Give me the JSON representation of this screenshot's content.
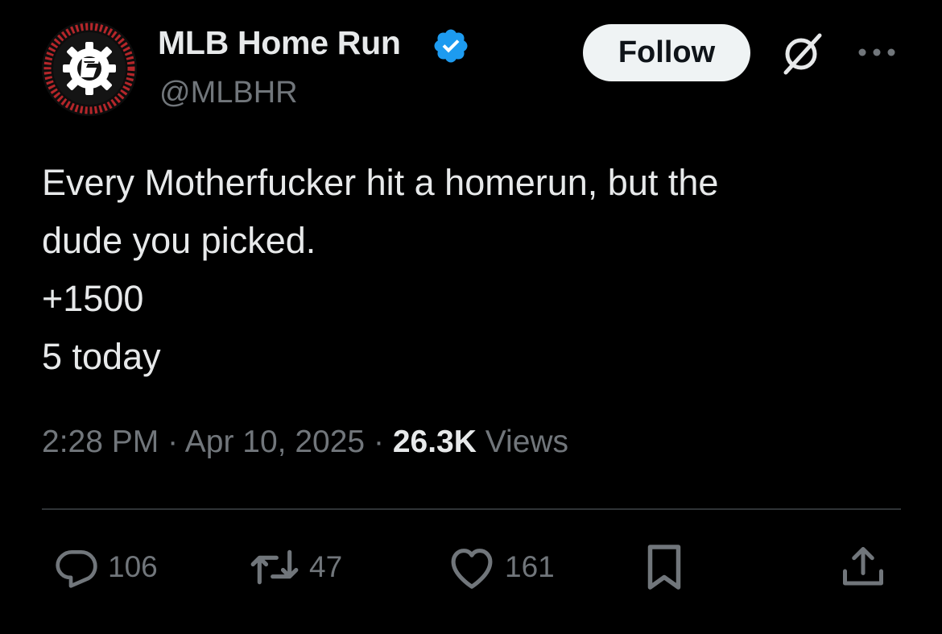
{
  "author": {
    "display_name": "MLB Home Run",
    "handle": "@MLBHR",
    "verified_color": "#1d9bf0",
    "avatar_icon": "gear-g-logo-icon"
  },
  "header": {
    "follow_label": "Follow",
    "grok_icon": "slashed-circle-icon",
    "more_icon": "ellipsis-icon"
  },
  "tweet": {
    "text": "Every Motherfucker hit a homerun, but the\ndude you picked.\n+1500\n5 today"
  },
  "meta": {
    "time": "2:28 PM",
    "separator": "·",
    "date": "Apr 10, 2025",
    "views_count": "26.3K",
    "views_label": "Views"
  },
  "actions": {
    "replies": "106",
    "reposts": "47",
    "likes": "161",
    "bookmark_icon": "bookmark-icon",
    "share_icon": "share-icon"
  },
  "colors": {
    "background": "#000000",
    "text": "#e7e9ea",
    "secondary": "#71767b",
    "divider": "#2f3336",
    "follow_bg": "#eff3f4",
    "avatar_ring": "#b5262a"
  }
}
